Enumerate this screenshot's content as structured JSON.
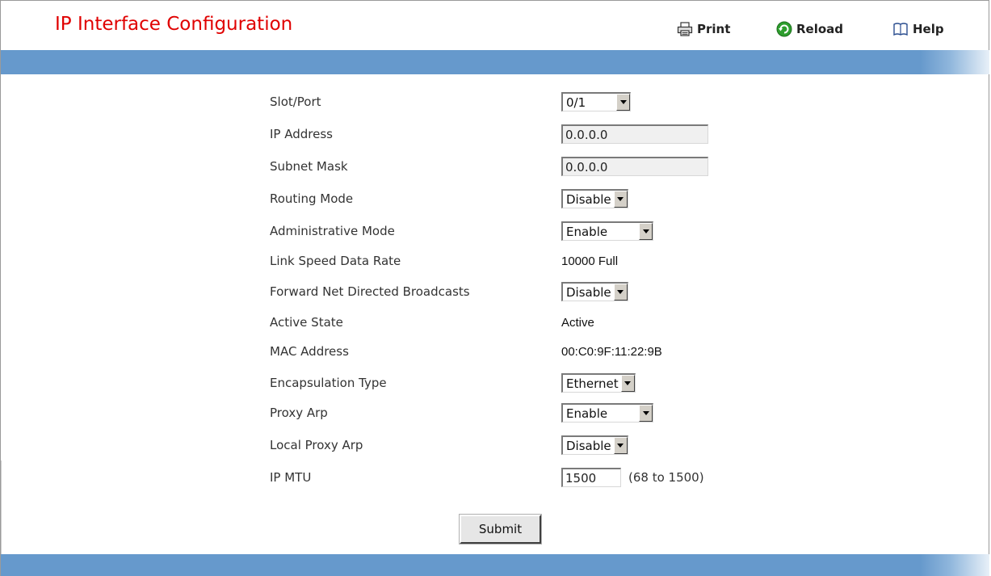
{
  "header": {
    "title": "IP Interface Configuration",
    "toolbar": {
      "print_label": "Print",
      "reload_label": "Reload",
      "help_label": "Help"
    }
  },
  "colors": {
    "title": "#e00000",
    "bar": "#6699cc"
  },
  "form": {
    "slot_port": {
      "label": "Slot/Port",
      "value": "0/1"
    },
    "ip_address": {
      "label": "IP Address",
      "value": "0.0.0.0"
    },
    "subnet_mask": {
      "label": "Subnet Mask",
      "value": "0.0.0.0"
    },
    "routing_mode": {
      "label": "Routing Mode",
      "value": "Disable"
    },
    "admin_mode": {
      "label": "Administrative Mode",
      "value": "Enable"
    },
    "link_speed": {
      "label": "Link Speed Data Rate",
      "value": "10000 Full"
    },
    "fwd_net_directed_bcast": {
      "label": "Forward Net Directed Broadcasts",
      "value": "Disable"
    },
    "active_state": {
      "label": "Active State",
      "value": "Active"
    },
    "mac_address": {
      "label": "MAC Address",
      "value": "00:C0:9F:11:22:9B"
    },
    "encapsulation_type": {
      "label": "Encapsulation Type",
      "value": "Ethernet"
    },
    "proxy_arp": {
      "label": "Proxy Arp",
      "value": "Enable"
    },
    "local_proxy_arp": {
      "label": "Local Proxy Arp",
      "value": "Disable"
    },
    "ip_mtu": {
      "label": "IP MTU",
      "value": "1500",
      "range_hint": "(68 to 1500)"
    }
  },
  "actions": {
    "submit_label": "Submit"
  },
  "icons": {
    "print": "printer-icon",
    "reload": "reload-icon",
    "help": "book-icon"
  }
}
